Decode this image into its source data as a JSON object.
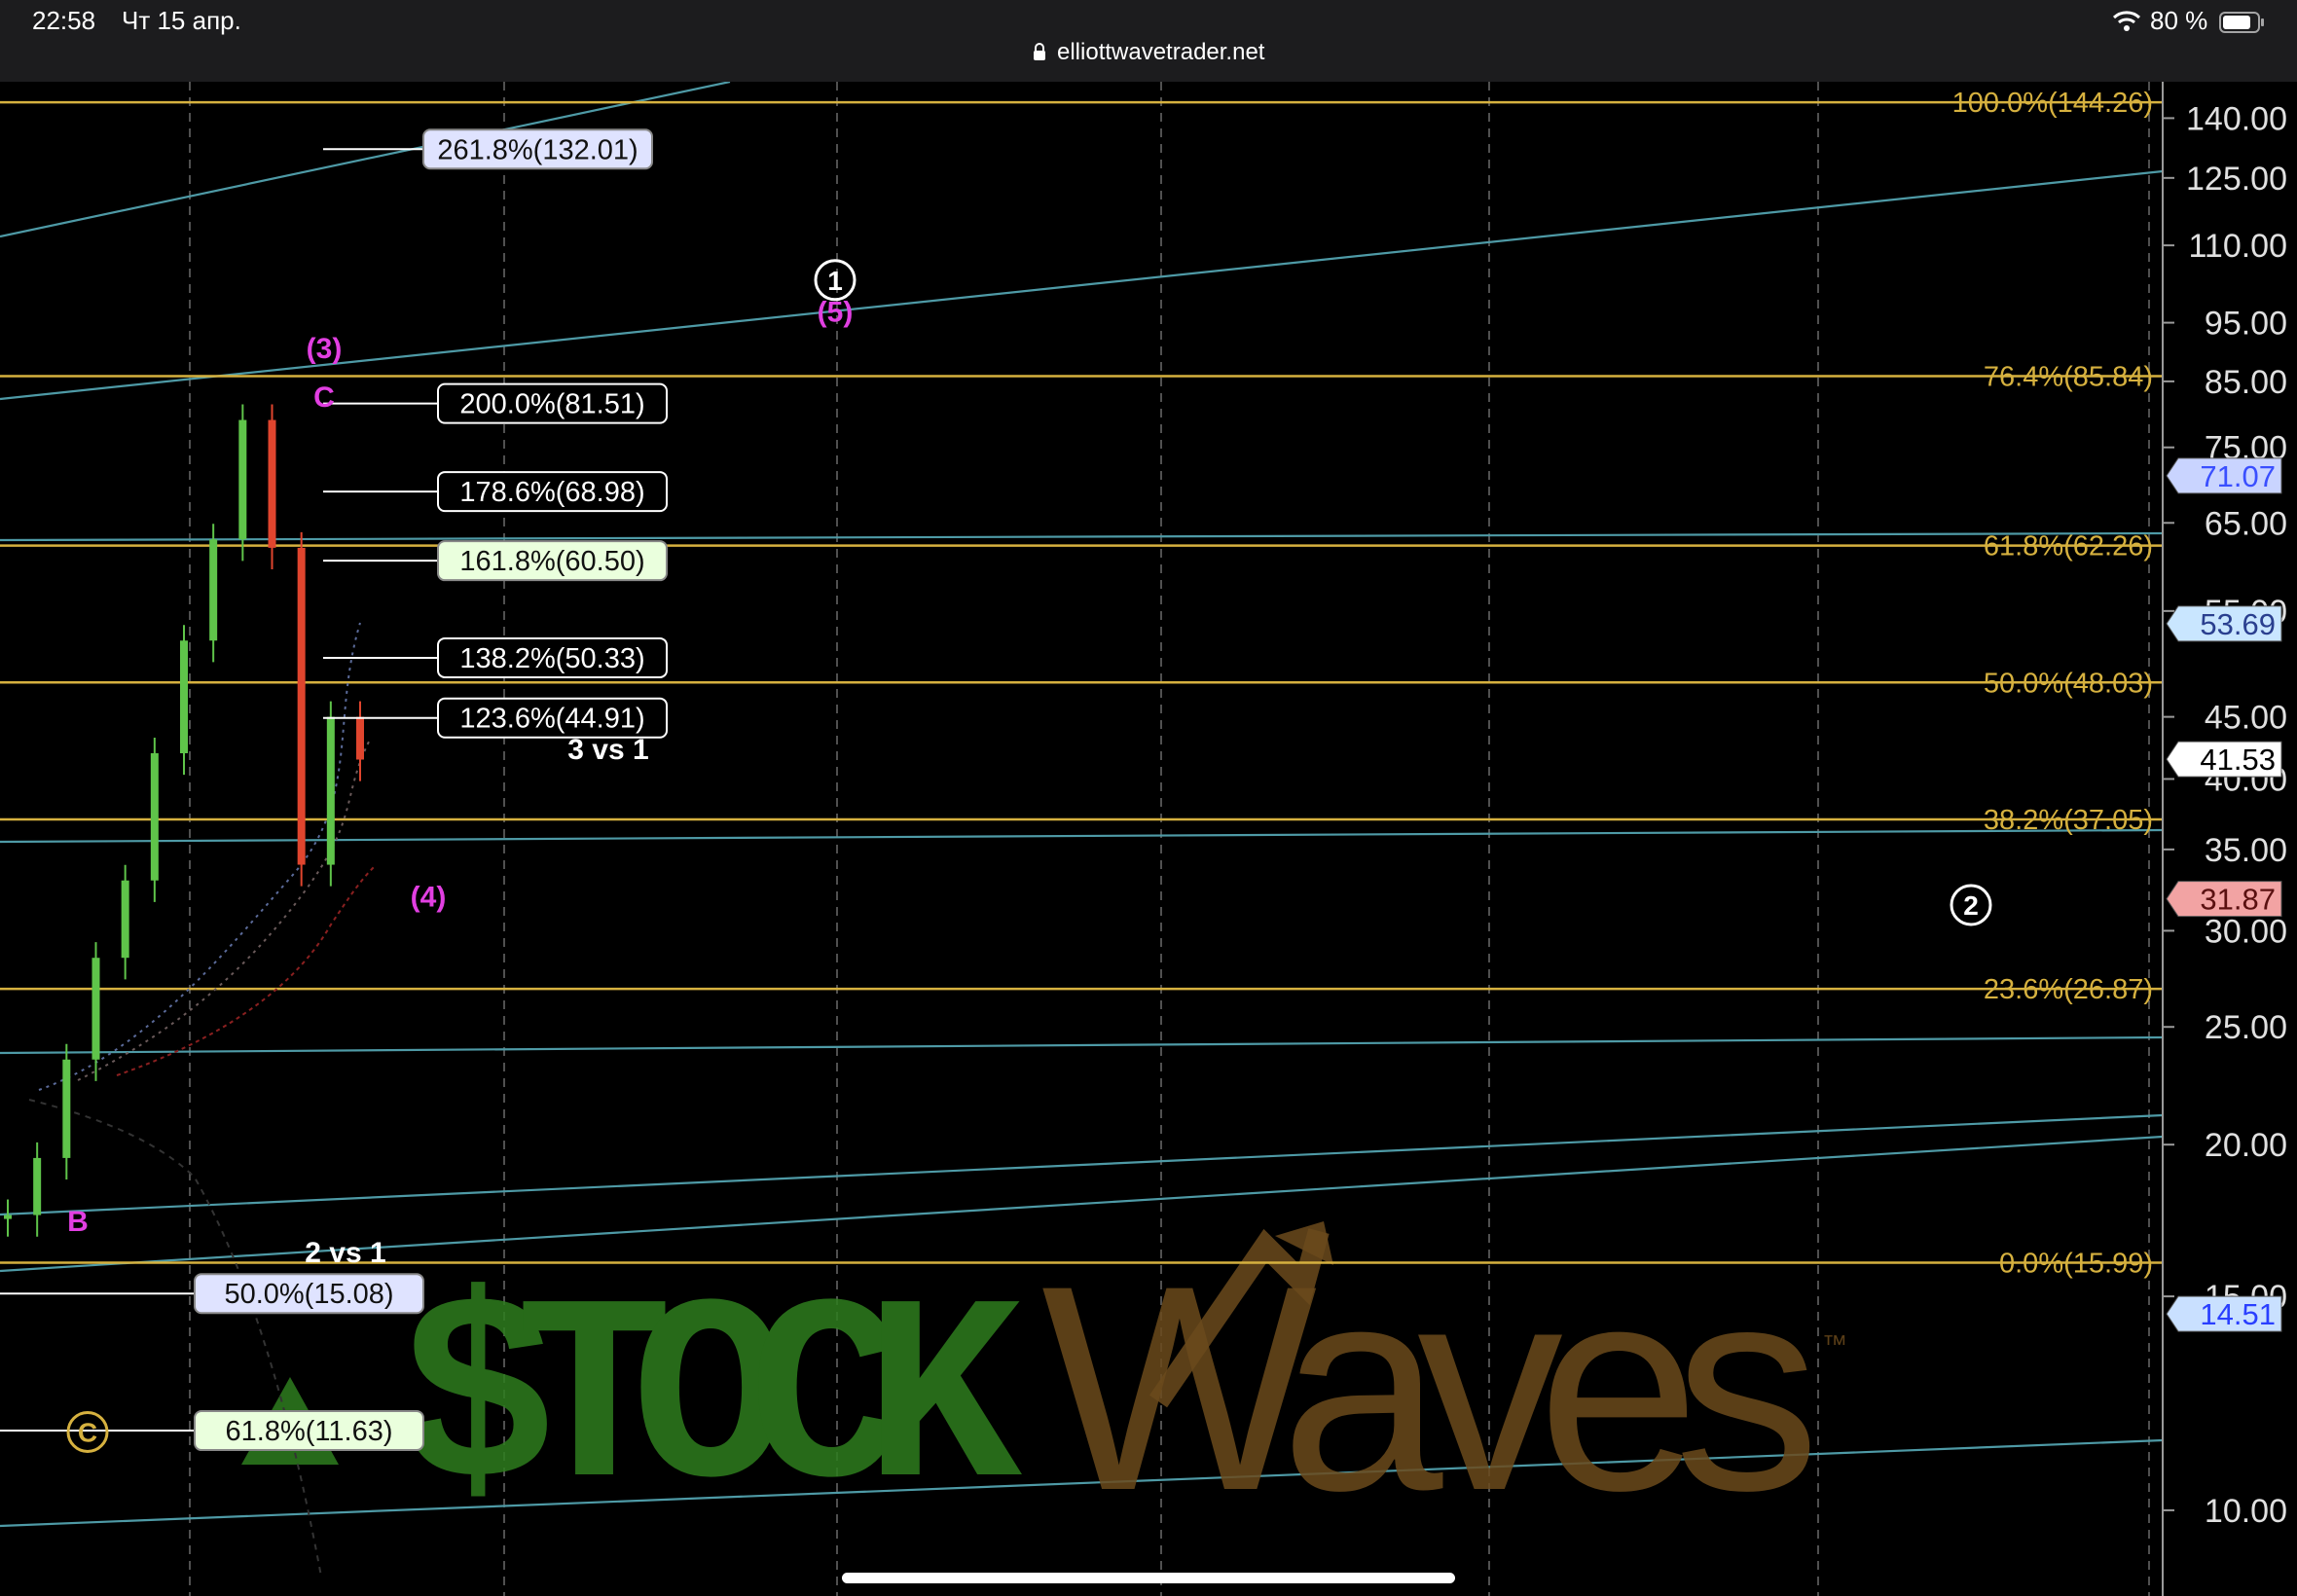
{
  "status_bar": {
    "time": "22:58",
    "date": "Чт 15 апр.",
    "url": "elliottwavetrader.net",
    "battery": "80 %",
    "icons": [
      "lock-icon",
      "wifi-icon",
      "battery-icon"
    ]
  },
  "watermark": {
    "text_left": "$TOCK",
    "text_right": "Waves",
    "tm": "™"
  },
  "chart_data": {
    "type": "line",
    "y_scale": "log",
    "ylim": [
      8.5,
      150
    ],
    "grid": "vertical dashed",
    "colors": {
      "fib_line": "#d6b13f",
      "channel": "#4e9aa6",
      "wave_label": "#e23fe2",
      "up_candle": "#5fc44a",
      "down_candle": "#e0452e"
    },
    "y_ticks": [
      "140.00",
      "125.00",
      "110.00",
      "95.00",
      "85.00",
      "75.00",
      "65.00",
      "55.00",
      "45.00",
      "40.00",
      "35.00",
      "30.00",
      "25.00",
      "20.00",
      "15.00",
      "10.00"
    ],
    "fib_retracements": [
      {
        "label": "100.0%(144.26)",
        "value": 144.26
      },
      {
        "label": "76.4%(85.84)",
        "value": 85.84
      },
      {
        "label": "61.8%(62.26)",
        "value": 62.26
      },
      {
        "label": "50.0%(48.03)",
        "value": 48.03
      },
      {
        "label": "38.2%(37.05)",
        "value": 37.05
      },
      {
        "label": "23.6%(26.87)",
        "value": 26.87
      },
      {
        "label": "0.0%(15.99)",
        "value": 15.99
      }
    ],
    "fib_extensions": [
      {
        "label": "261.8%(132.01)",
        "value": 132.01,
        "fill": "#dfe3ff"
      },
      {
        "label": "200.0%(81.51)",
        "value": 81.51,
        "fill": "#000000"
      },
      {
        "label": "178.6%(68.98)",
        "value": 68.98,
        "fill": "#000000"
      },
      {
        "label": "161.8%(60.50)",
        "value": 60.5,
        "fill": "#eaffdd"
      },
      {
        "label": "138.2%(50.33)",
        "value": 50.33,
        "fill": "#000000"
      },
      {
        "label": "123.6%(44.91)",
        "value": 44.91,
        "fill": "#000000"
      },
      {
        "label": "50.0%(15.08)",
        "value": 15.08,
        "fill": "#dfe3ff"
      },
      {
        "label": "61.8%(11.63)",
        "value": 11.63,
        "fill": "#eaffdd"
      }
    ],
    "price_tags": [
      {
        "label": "71.07",
        "value": 71.07,
        "fill": "#c9d4ff",
        "text": "#3a4fff"
      },
      {
        "label": "53.69",
        "value": 53.69,
        "fill": "#c9e6ff",
        "text": "#2a3f8f"
      },
      {
        "label": "41.53",
        "value": 41.53,
        "fill": "#ffffff",
        "text": "#000000"
      },
      {
        "label": "31.87",
        "value": 31.87,
        "fill": "#f2a3a3",
        "text": "#5a1010"
      },
      {
        "label": "14.51",
        "value": 14.51,
        "fill": "#c9e0ff",
        "text": "#2a3fff"
      }
    ],
    "wave_labels": [
      {
        "text": "(3)",
        "value": 90.5,
        "color": "#e23fe2"
      },
      {
        "text": "C",
        "value": 82.5,
        "color": "#e23fe2"
      },
      {
        "text": "(5)",
        "value": 97,
        "color": "#e23fe2"
      },
      {
        "text": "(4)",
        "value": 32,
        "color": "#e23fe2"
      },
      {
        "text": "B",
        "value": 17.3,
        "color": "#e23fe2"
      },
      {
        "text": "3 vs 1",
        "value": 42.3,
        "color": "#ffffff"
      },
      {
        "text": "2 vs 1",
        "value": 16.3,
        "color": "#ffffff"
      }
    ],
    "circled_labels": [
      {
        "text": "1",
        "value": 103
      },
      {
        "text": "2",
        "value": 31.5
      },
      {
        "text": "C",
        "value": 11.6
      }
    ],
    "price_series": [
      {
        "label": "B",
        "value": 17.5
      },
      {
        "label": "",
        "value": 19.5
      },
      {
        "label": "",
        "value": 23.5
      },
      {
        "label": "",
        "value": 28.5
      },
      {
        "label": "",
        "value": 33
      },
      {
        "label": "",
        "value": 42
      },
      {
        "label": "",
        "value": 52
      },
      {
        "label": "",
        "value": 63
      },
      {
        "label": "C",
        "value": 79
      },
      {
        "label": "",
        "value": 62
      },
      {
        "label": "",
        "value": 34
      },
      {
        "label": "",
        "value": 45
      },
      {
        "label": "",
        "value": 41.5
      }
    ]
  }
}
